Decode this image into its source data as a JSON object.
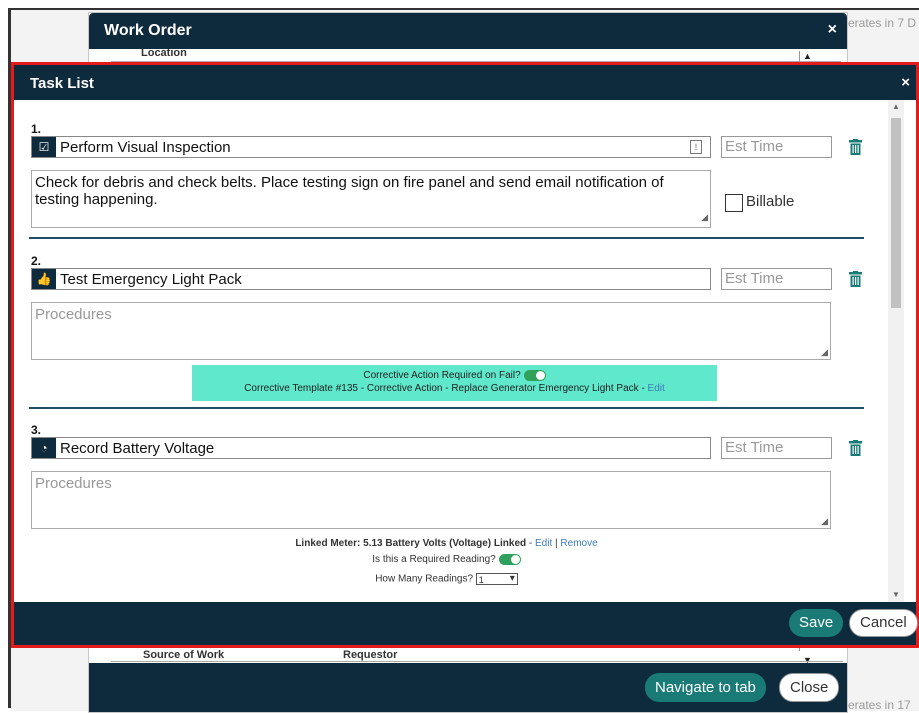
{
  "background": {
    "right_text_top": "erates in 7 D",
    "right_text_bottom": "erates in 17"
  },
  "work_order": {
    "title": "Work Order",
    "close_label": "×",
    "row_location": "Location",
    "row_source_label": "Source of Work",
    "row_source_value": "Requestor",
    "navigate_label": "Navigate to tab",
    "close_button_label": "Close"
  },
  "task_list": {
    "title": "Task List",
    "close_label": "×",
    "save_label": "Save",
    "cancel_label": "Cancel",
    "est_time_placeholder": "Est Time",
    "procedures_placeholder": "Procedures",
    "tasks": [
      {
        "number": "1.",
        "title": "Perform Visual Inspection",
        "icon": "checkbox-icon",
        "procedures": "Check for debris and check belts. Place testing sign on fire panel and send email notification of testing happening.",
        "billable_label": "Billable"
      },
      {
        "number": "2.",
        "title": "Test Emergency Light Pack",
        "icon": "thumbs-up-icon",
        "corrective_required_label": "Corrective Action Required on Fail?",
        "corrective_template": "Corrective Template #135 - Corrective Action - Replace Generator Emergency Light Pack",
        "edit_label": "Edit"
      },
      {
        "number": "3.",
        "title": "Record Battery Voltage",
        "icon": "gauge-icon",
        "linked_meter": "Linked Meter: 5.13 Battery Volts (Voltage) Linked",
        "edit_label": "Edit",
        "remove_label": "Remove",
        "required_reading_label": "Is this a Required Reading?",
        "how_many_label": "How Many Readings?",
        "how_many_value": "1"
      }
    ]
  },
  "colors": {
    "navy": "#0e2a3d",
    "teal": "#1a7a75",
    "highlight_red": "#e31b1b",
    "corrective_bg": "#5fe8cc",
    "toggle_green": "#2fa15a"
  }
}
